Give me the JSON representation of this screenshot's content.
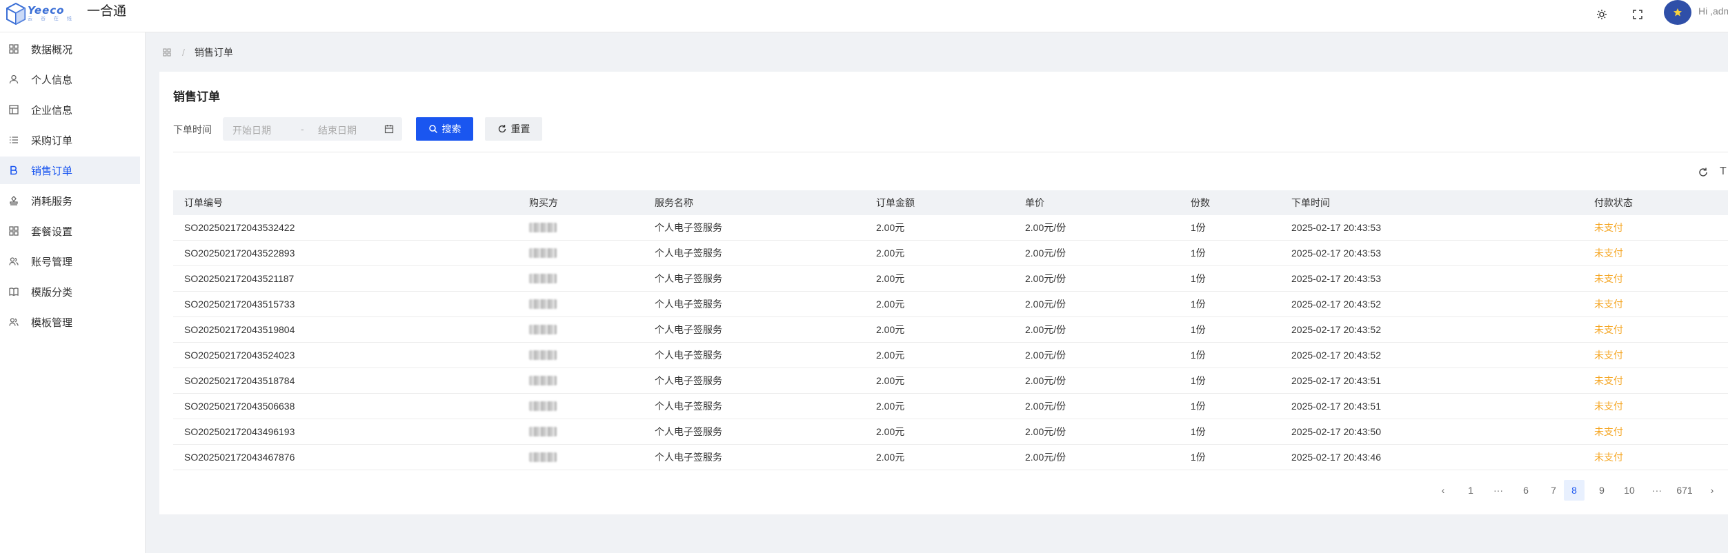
{
  "app": {
    "logo_word": "Yeeco",
    "logo_sub": "云 谷 在 线",
    "title": "一合通",
    "greeting": "Hi ,admin"
  },
  "sidebar": {
    "items": [
      {
        "label": "数据概况",
        "icon": "grid-icon"
      },
      {
        "label": "个人信息",
        "icon": "user-icon"
      },
      {
        "label": "企业信息",
        "icon": "table-icon"
      },
      {
        "label": "采购订单",
        "icon": "list-icon"
      },
      {
        "label": "销售订单",
        "icon": "b-letter-icon",
        "active": true
      },
      {
        "label": "消耗服务",
        "icon": "stamp-icon"
      },
      {
        "label": "套餐设置",
        "icon": "grid-icon"
      },
      {
        "label": "账号管理",
        "icon": "users-icon"
      },
      {
        "label": "模版分类",
        "icon": "book-icon"
      },
      {
        "label": "模板管理",
        "icon": "users-icon"
      }
    ]
  },
  "breadcrumb": {
    "current": "销售订单"
  },
  "page": {
    "title": "销售订单",
    "filter_label": "下单时间",
    "date_start_placeholder": "开始日期",
    "date_sep": "-",
    "date_end_placeholder": "结束日期",
    "search_label": "搜索",
    "reset_label": "重置",
    "density_label": "T"
  },
  "table": {
    "headers": [
      "订单编号",
      "购买方",
      "服务名称",
      "订单金额",
      "单价",
      "份数",
      "下单时间",
      "付款状态"
    ],
    "rows": [
      [
        "SO202502172043532422",
        "",
        "个人电子签服务",
        "2.00元",
        "2.00元/份",
        "1份",
        "2025-02-17 20:43:53",
        "未支付"
      ],
      [
        "SO202502172043522893",
        "",
        "个人电子签服务",
        "2.00元",
        "2.00元/份",
        "1份",
        "2025-02-17 20:43:53",
        "未支付"
      ],
      [
        "SO202502172043521187",
        "",
        "个人电子签服务",
        "2.00元",
        "2.00元/份",
        "1份",
        "2025-02-17 20:43:53",
        "未支付"
      ],
      [
        "SO202502172043515733",
        "",
        "个人电子签服务",
        "2.00元",
        "2.00元/份",
        "1份",
        "2025-02-17 20:43:52",
        "未支付"
      ],
      [
        "SO202502172043519804",
        "",
        "个人电子签服务",
        "2.00元",
        "2.00元/份",
        "1份",
        "2025-02-17 20:43:52",
        "未支付"
      ],
      [
        "SO202502172043524023",
        "",
        "个人电子签服务",
        "2.00元",
        "2.00元/份",
        "1份",
        "2025-02-17 20:43:52",
        "未支付"
      ],
      [
        "SO202502172043518784",
        "",
        "个人电子签服务",
        "2.00元",
        "2.00元/份",
        "1份",
        "2025-02-17 20:43:51",
        "未支付"
      ],
      [
        "SO202502172043506638",
        "",
        "个人电子签服务",
        "2.00元",
        "2.00元/份",
        "1份",
        "2025-02-17 20:43:51",
        "未支付"
      ],
      [
        "SO202502172043496193",
        "",
        "个人电子签服务",
        "2.00元",
        "2.00元/份",
        "1份",
        "2025-02-17 20:43:50",
        "未支付"
      ],
      [
        "SO202502172043467876",
        "",
        "个人电子签服务",
        "2.00元",
        "2.00元/份",
        "1份",
        "2025-02-17 20:43:46",
        "未支付"
      ]
    ]
  },
  "pagination": {
    "prev": "‹",
    "pages": [
      "1",
      "···",
      "6",
      "7",
      "8",
      "9",
      "10",
      "···",
      "671"
    ],
    "current": "8",
    "next": "›"
  },
  "colors": {
    "primary": "#1a56f0",
    "unpaid": "#f5a623",
    "avatar": "#2f4fa8"
  }
}
